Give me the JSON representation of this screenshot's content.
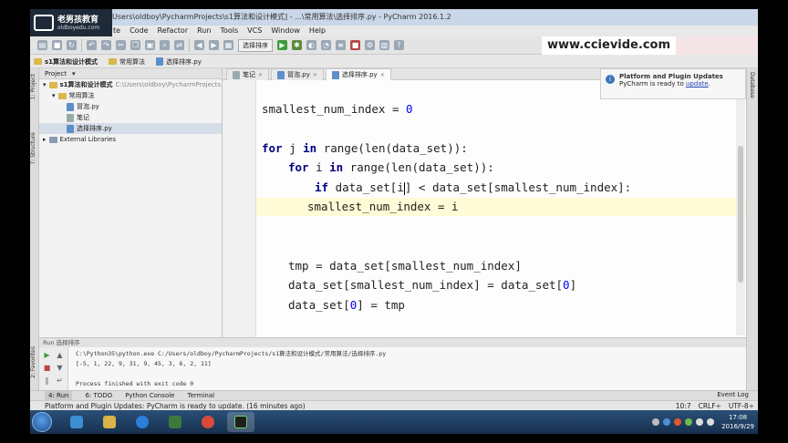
{
  "logo": {
    "name": "老男孩教育",
    "url": "oldboyedu.com"
  },
  "window": {
    "title": "Users\\oldboy\\PycharmProjects\\s1算法和设计模式] - ...\\常用算法\\选择排序.py - PyCharm 2016.1.2"
  },
  "menu": [
    "te",
    "Code",
    "Refactor",
    "Run",
    "Tools",
    "VCS",
    "Window",
    "Help"
  ],
  "toolbar": {
    "run_config": "选择排序",
    "watermark": "www.ccievide.com"
  },
  "breadcrumb": [
    {
      "label": "s1算法和设计模式",
      "icon": "folder-icon"
    },
    {
      "label": "常用算法",
      "icon": "folder-icon"
    },
    {
      "label": "选择排序.py",
      "icon": "python-file-icon"
    }
  ],
  "left_stripe": {
    "project": "1: Project",
    "structure": "7: Structure",
    "favorites": "2: Favorites"
  },
  "project": {
    "header": "Project",
    "root_label": "s1算法和设计模式",
    "root_path": "C:\\Users\\oldboy\\PycharmProjects",
    "items": [
      {
        "label": "常用算法",
        "type": "folder"
      },
      {
        "label": "冒泡.py",
        "type": "file"
      },
      {
        "label": "笔记",
        "type": "file"
      },
      {
        "label": "选择排序.py",
        "type": "file"
      }
    ],
    "external": "External Libraries"
  },
  "editor_tabs": [
    {
      "label": "笔记",
      "active": false
    },
    {
      "label": "冒泡.py",
      "active": false
    },
    {
      "label": "选择排序.py",
      "active": true
    }
  ],
  "code": {
    "l1_var": "smallest_num_index = ",
    "l1_num": "0",
    "l2_kw": "for",
    "l2_rest": " j ",
    "l2_kw2": "in",
    "l2_tail": " range(len(data_set)):",
    "l3_kw": "for",
    "l3_rest": " i ",
    "l3_kw2": "in",
    "l3_tail": " range(len(data_set)):",
    "l4_kw": "if",
    "l4_pre": " data_set[i",
    "l4_post": "] < data_set[smallest_num_index]:",
    "l5": "smallest_num_index = i",
    "l6": "tmp = data_set[smallest_num_index]",
    "l7_pre": "data_set[smallest_num_index] = data_set[",
    "l7_num": "0",
    "l7_post": "]",
    "l8_pre": "data_set[",
    "l8_num": "0",
    "l8_post": "] = tmp"
  },
  "notification": {
    "title": "Platform and Plugin Updates",
    "text": "PyCharm is ready to ",
    "link": "update",
    "end": "."
  },
  "right_stripe": "Database",
  "run_panel": {
    "header": "Run   选择排序",
    "cmd": "C:\\Python35\\python.exe C:/Users/oldboy/PycharmProjects/s1算法和设计模式/常用算法/选择排序.py",
    "output": "[-5, 1, 22, 9, 31, 9, 45, 3, 6, 2, 11]",
    "exit": "Process finished with exit code 0"
  },
  "tool_tabs": [
    "4: Run",
    "6: TODO",
    "Python Console",
    "Terminal"
  ],
  "event_log": "Event Log",
  "status": {
    "message": "Platform and Plugin Updates: PyCharm is ready to update. (16 minutes ago)",
    "position": "10:7",
    "line_sep": "CRLF÷",
    "encoding": "UTF-8÷"
  },
  "taskbar": {
    "time": "17:08",
    "date": "2016/9/29"
  }
}
